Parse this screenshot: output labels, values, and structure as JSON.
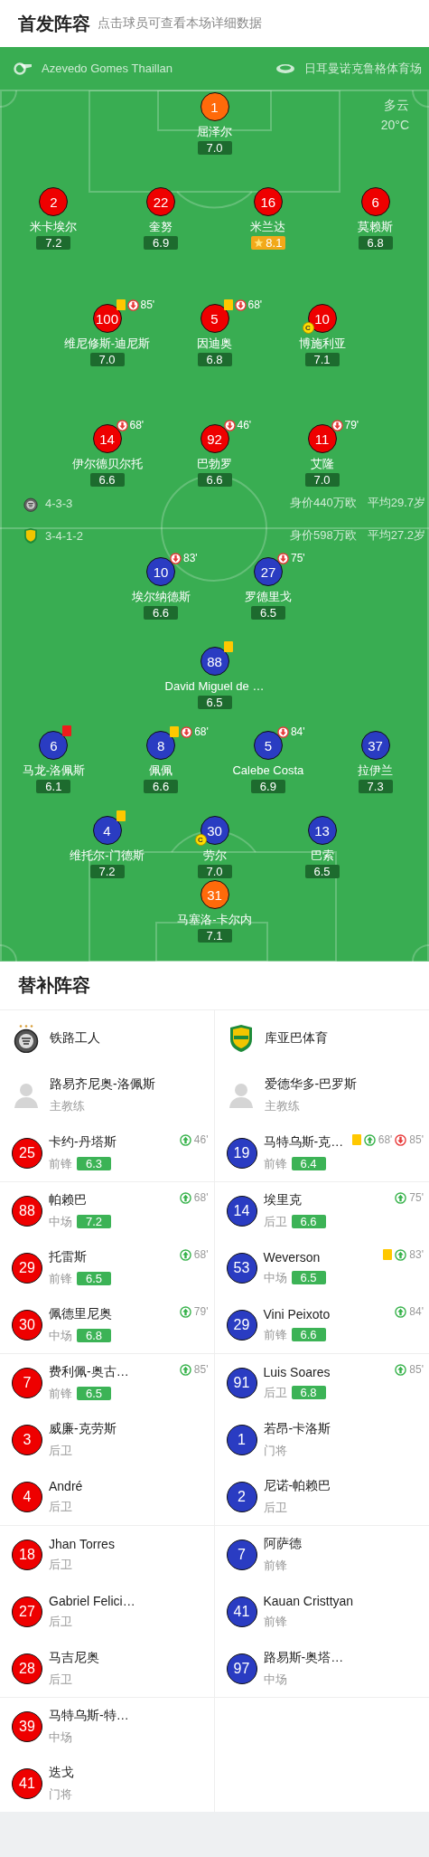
{
  "header": {
    "title": "首发阵容",
    "hint": "点击球员可查看本场详细数据"
  },
  "match_info": {
    "referee": "Azevedo Gomes Thaillan",
    "stadium": "日耳曼诺克鲁格体育场",
    "weather": "多云",
    "temperature": "20°C"
  },
  "home": {
    "formation": "4-3-3",
    "value": "身价440万欧",
    "age": "平均29.7岁",
    "lines": [
      [
        {
          "number": "1",
          "name": "屈泽尔",
          "rating": "7.0",
          "keeper": true,
          "best": false
        }
      ],
      [
        {
          "number": "2",
          "name": "米卡埃尔",
          "rating": "7.2",
          "keeper": false,
          "best": false
        },
        {
          "number": "22",
          "name": "奎努",
          "rating": "6.9",
          "keeper": false,
          "best": false
        },
        {
          "number": "16",
          "name": "米兰达",
          "rating": "8.1",
          "keeper": false,
          "best": true
        },
        {
          "number": "6",
          "name": "莫赖斯",
          "rating": "6.8",
          "keeper": false,
          "best": false
        }
      ],
      [
        {
          "number": "100",
          "name": "维尼修斯-迪尼斯",
          "rating": "7.0",
          "keeper": false,
          "best": false,
          "events": [
            {
              "kind": "yellow"
            },
            {
              "kind": "sub_off",
              "minute": "85'"
            }
          ]
        },
        {
          "number": "5",
          "name": "因迪奥",
          "rating": "6.8",
          "keeper": false,
          "best": false,
          "events": [
            {
              "kind": "yellow"
            },
            {
              "kind": "sub_off",
              "minute": "68'"
            }
          ]
        },
        {
          "number": "10",
          "name": "博施利亚",
          "rating": "7.1",
          "keeper": false,
          "best": false,
          "captain": "C"
        }
      ],
      [
        {
          "number": "14",
          "name": "伊尔德贝尔托",
          "rating": "6.6",
          "keeper": false,
          "best": false,
          "events": [
            {
              "kind": "sub_off",
              "minute": "68'"
            }
          ]
        },
        {
          "number": "92",
          "name": "巴勃罗",
          "rating": "6.6",
          "keeper": false,
          "best": false,
          "events": [
            {
              "kind": "sub_off",
              "minute": "46'"
            }
          ]
        },
        {
          "number": "11",
          "name": "艾隆",
          "rating": "7.0",
          "keeper": false,
          "best": false,
          "events": [
            {
              "kind": "sub_off",
              "minute": "79'"
            }
          ]
        }
      ]
    ]
  },
  "away": {
    "formation": "3-4-1-2",
    "value": "身价598万欧",
    "age": "平均27.2岁",
    "lines": [
      [
        {
          "number": "10",
          "name": "埃尔纳德斯",
          "rating": "6.6",
          "keeper": false,
          "best": false,
          "events": [
            {
              "kind": "sub_off",
              "minute": "83'"
            }
          ]
        },
        {
          "number": "27",
          "name": "罗德里戈",
          "rating": "6.5",
          "keeper": false,
          "best": false,
          "events": [
            {
              "kind": "sub_off",
              "minute": "75'"
            }
          ]
        }
      ],
      [
        {
          "number": "88",
          "name": "David Miguel de …",
          "rating": "6.5",
          "keeper": false,
          "best": false,
          "events": [
            {
              "kind": "yellow"
            }
          ]
        }
      ],
      [
        {
          "number": "6",
          "name": "马龙-洛佩斯",
          "rating": "6.1",
          "keeper": false,
          "best": false,
          "events": [
            {
              "kind": "red"
            }
          ]
        },
        {
          "number": "8",
          "name": "佩佩",
          "rating": "6.6",
          "keeper": false,
          "best": false,
          "events": [
            {
              "kind": "yellow"
            },
            {
              "kind": "sub_off",
              "minute": "68'"
            }
          ]
        },
        {
          "number": "5",
          "name": "Calebe Costa",
          "rating": "6.9",
          "keeper": false,
          "best": false,
          "events": [
            {
              "kind": "sub_off",
              "minute": "84'"
            }
          ]
        },
        {
          "number": "37",
          "name": "拉伊兰",
          "rating": "7.3",
          "keeper": false,
          "best": false
        }
      ],
      [
        {
          "number": "4",
          "name": "维托尔-门德斯",
          "rating": "7.2",
          "keeper": false,
          "best": false,
          "events": [
            {
              "kind": "yellow"
            }
          ]
        },
        {
          "number": "30",
          "name": "劳尔",
          "rating": "7.0",
          "keeper": false,
          "best": false,
          "captain": "C"
        },
        {
          "number": "13",
          "name": "巴索",
          "rating": "6.5",
          "keeper": false,
          "best": false
        }
      ],
      [
        {
          "number": "31",
          "name": "马塞洛-卡尔内",
          "rating": "7.1",
          "keeper": true,
          "best": false
        }
      ]
    ]
  },
  "bench": {
    "title": "替补阵容",
    "home_team": {
      "name": "铁路工人",
      "coach": "路易齐尼奥-洛佩斯",
      "coach_role": "主教练"
    },
    "away_team": {
      "name": "库亚巴体育",
      "coach": "爱德华多-巴罗斯",
      "coach_role": "主教练"
    },
    "groups": [
      {
        "home": [
          {
            "number": "25",
            "name": "卡约-丹塔斯",
            "position": "前锋",
            "rating": "6.3",
            "events": [
              {
                "kind": "sub_on",
                "minute": "46'"
              }
            ]
          }
        ],
        "away": [
          {
            "number": "19",
            "name": "马特乌斯-克…",
            "position": "前锋",
            "rating": "6.4",
            "events": [
              {
                "kind": "yellow"
              },
              {
                "kind": "sub_on",
                "minute": "68'"
              },
              {
                "kind": "sub_off",
                "minute": "85'"
              }
            ]
          }
        ]
      },
      {
        "home": [
          {
            "number": "88",
            "name": "帕赖巴",
            "position": "中场",
            "rating": "7.2",
            "events": [
              {
                "kind": "sub_on",
                "minute": "68'"
              }
            ]
          },
          {
            "number": "29",
            "name": "托雷斯",
            "position": "前锋",
            "rating": "6.5",
            "events": [
              {
                "kind": "sub_on",
                "minute": "68'"
              }
            ]
          },
          {
            "number": "30",
            "name": "佩德里尼奥",
            "position": "中场",
            "rating": "6.8",
            "events": [
              {
                "kind": "sub_on",
                "minute": "79'"
              }
            ]
          }
        ],
        "away": [
          {
            "number": "14",
            "name": "埃里克",
            "position": "后卫",
            "rating": "6.6",
            "events": [
              {
                "kind": "sub_on",
                "minute": "75'"
              }
            ]
          },
          {
            "number": "53",
            "name": "Weverson",
            "position": "中场",
            "rating": "6.5",
            "events": [
              {
                "kind": "yellow"
              },
              {
                "kind": "sub_on",
                "minute": "83'"
              }
            ]
          },
          {
            "number": "29",
            "name": "Vini Peixoto",
            "position": "前锋",
            "rating": "6.6",
            "events": [
              {
                "kind": "sub_on",
                "minute": "84'"
              }
            ]
          }
        ]
      },
      {
        "home": [
          {
            "number": "7",
            "name": "费利佩-奥古…",
            "position": "前锋",
            "rating": "6.5",
            "events": [
              {
                "kind": "sub_on",
                "minute": "85'"
              }
            ]
          },
          {
            "number": "3",
            "name": "威廉-克劳斯",
            "position": "后卫"
          },
          {
            "number": "4",
            "name": "André",
            "position": "后卫"
          }
        ],
        "away": [
          {
            "number": "91",
            "name": "Luis Soares",
            "position": "后卫",
            "rating": "6.8",
            "events": [
              {
                "kind": "sub_on",
                "minute": "85'"
              }
            ]
          },
          {
            "number": "1",
            "name": "若昂-卡洛斯",
            "position": "门将"
          },
          {
            "number": "2",
            "name": "尼诺-帕赖巴",
            "position": "后卫"
          }
        ]
      },
      {
        "home": [
          {
            "number": "18",
            "name": "Jhan Torres",
            "position": "后卫"
          },
          {
            "number": "27",
            "name": "Gabriel Felici…",
            "position": "后卫"
          },
          {
            "number": "28",
            "name": "马吉尼奥",
            "position": "后卫"
          }
        ],
        "away": [
          {
            "number": "7",
            "name": "阿萨德",
            "position": "前锋"
          },
          {
            "number": "41",
            "name": "Kauan Cristtyan",
            "position": "前锋"
          },
          {
            "number": "97",
            "name": "路易斯-奥塔…",
            "position": "中场"
          }
        ]
      },
      {
        "home": [
          {
            "number": "39",
            "name": "马特乌斯-特…",
            "position": "中场"
          },
          {
            "number": "41",
            "name": "迭戈",
            "position": "门将"
          }
        ]
      }
    ]
  }
}
